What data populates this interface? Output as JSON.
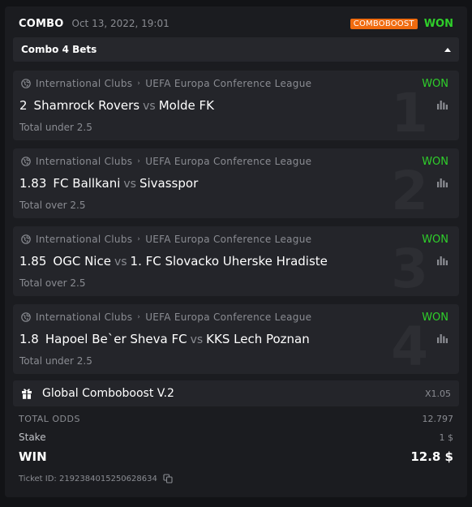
{
  "header": {
    "title": "COMBO",
    "date": "Oct 13, 2022, 19:01",
    "badge": "COMBOBOOST",
    "status": "WON"
  },
  "combo": {
    "label": "Combo 4 Bets"
  },
  "bets": [
    {
      "index": "1",
      "sport": "International Clubs",
      "league": "UEFA Europa Conference League",
      "status": "WON",
      "odds": "2",
      "home": "Shamrock Rovers",
      "vs": "vs",
      "away": "Molde FK",
      "market": "Total under 2.5"
    },
    {
      "index": "2",
      "sport": "International Clubs",
      "league": "UEFA Europa Conference League",
      "status": "WON",
      "odds": "1.83",
      "home": "FC Ballkani",
      "vs": "vs",
      "away": "Sivasspor",
      "market": "Total over 2.5"
    },
    {
      "index": "3",
      "sport": "International Clubs",
      "league": "UEFA Europa Conference League",
      "status": "WON",
      "odds": "1.85",
      "home": "OGC Nice",
      "vs": "vs",
      "away": "1. FC Slovacko Uherske Hradiste",
      "market": "Total over 2.5"
    },
    {
      "index": "4",
      "sport": "International Clubs",
      "league": "UEFA Europa Conference League",
      "status": "WON",
      "odds": "1.8",
      "home": "Hapoel Be`er Sheva FC",
      "vs": "vs",
      "away": "KKS Lech Poznan",
      "market": "Total under 2.5"
    }
  ],
  "global_boost": {
    "label": "Global Comboboost V.2",
    "multiplier": "X1.05"
  },
  "summary": {
    "total_odds_label": "TOTAL ODDS",
    "total_odds_value": "12.797",
    "stake_label": "Stake",
    "stake_value": "1 $",
    "win_label": "WIN",
    "win_value": "12.8 $"
  },
  "ticket": {
    "text": "Ticket ID: 2192384015250628634"
  },
  "colors": {
    "won": "#2fcf2a",
    "badge": "#f06b0f",
    "background": "#121316",
    "card": "#1b1c20"
  },
  "icons": [
    "globe-icon",
    "chevron-right-icon",
    "stats-icon",
    "gift-icon",
    "copy-icon",
    "caret-up-icon"
  ]
}
